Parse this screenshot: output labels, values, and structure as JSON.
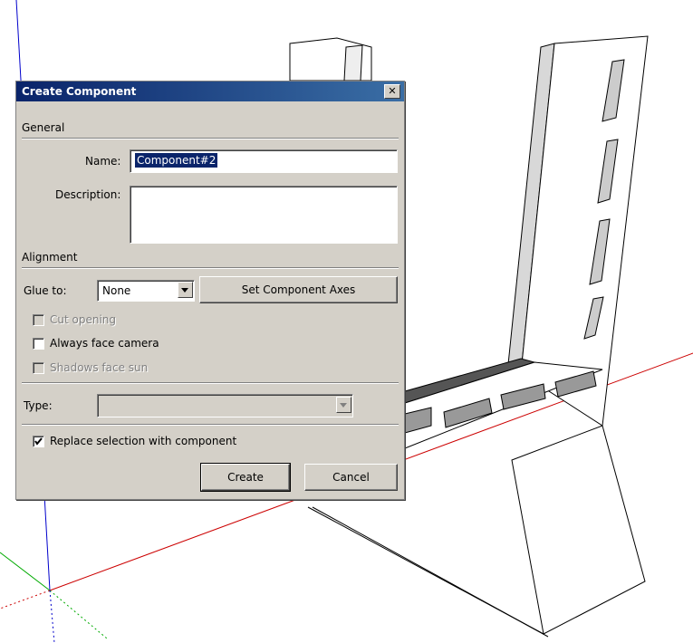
{
  "dialog": {
    "title": "Create Component",
    "close_glyph": "✕",
    "sections": {
      "general": "General",
      "alignment": "Alignment"
    },
    "name_label": "Name:",
    "name_value": "Component#2",
    "description_label": "Description:",
    "description_value": "",
    "glue_label": "Glue to:",
    "glue_value": "None",
    "set_axes_label": "Set Component Axes",
    "cut_opening_label": "Cut opening",
    "cut_opening_checked": false,
    "always_face_camera_label": "Always face camera",
    "always_face_camera_checked": false,
    "shadows_face_sun_label": "Shadows face sun",
    "shadows_face_sun_checked": false,
    "type_label": "Type:",
    "type_value": "",
    "replace_selection_label": "Replace selection with component",
    "replace_selection_checked": true,
    "create_label": "Create",
    "cancel_label": "Cancel"
  },
  "colors": {
    "titlebar_start": "#0a246a",
    "titlebar_end": "#3a6ea5",
    "dialog_bg": "#d4d0c8",
    "axis_red": "#cc0000",
    "axis_green": "#00aa00",
    "axis_blue": "#0000cc"
  }
}
